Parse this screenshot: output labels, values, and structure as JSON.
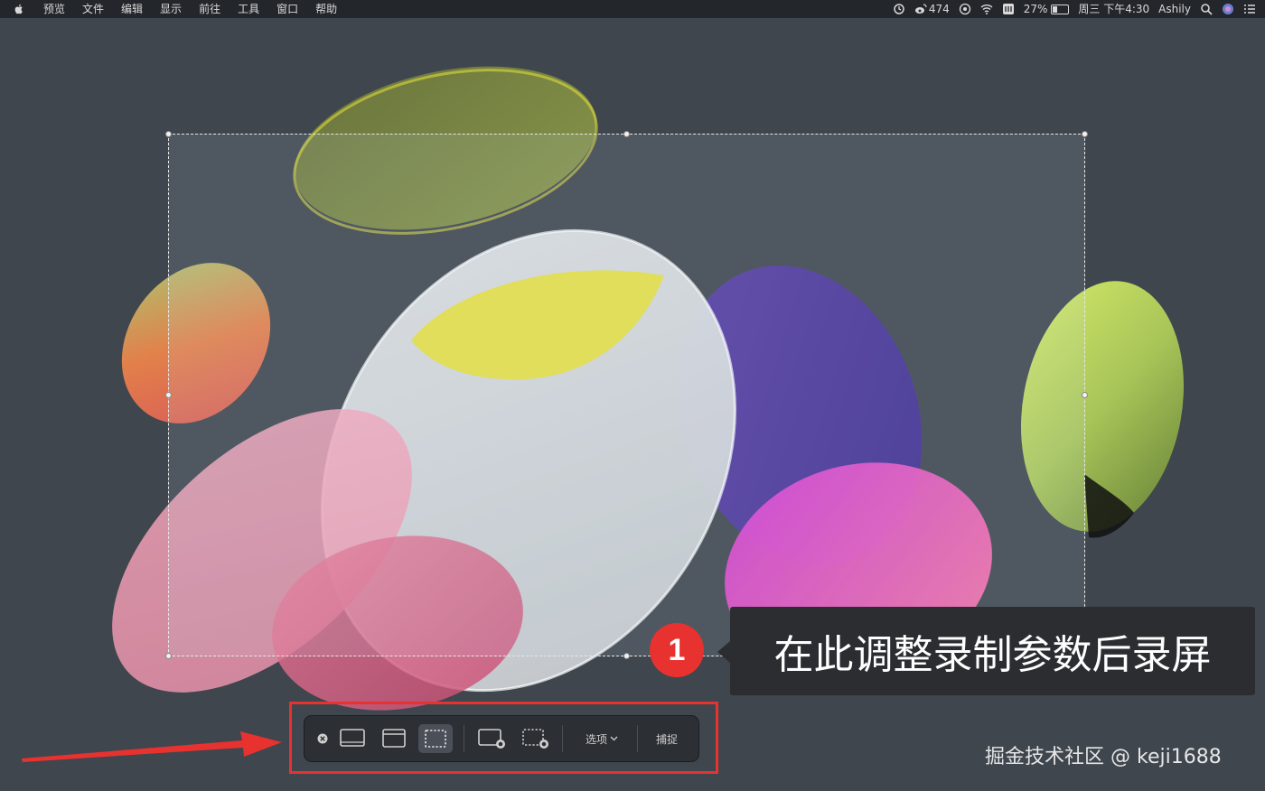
{
  "menubar": {
    "items": [
      "预览",
      "文件",
      "编辑",
      "显示",
      "前往",
      "工具",
      "窗口",
      "帮助"
    ],
    "status": {
      "weibo_count": "474",
      "battery": "27%",
      "datetime": "周三 下午4:30",
      "user": "Ashily"
    }
  },
  "toolbar": {
    "options_label": "选项",
    "capture_label": "捕捉"
  },
  "callout": {
    "step": "1",
    "text": "在此调整录制参数后录屏"
  },
  "watermark": "掘金技术社区 @ keji1688",
  "colors": {
    "accent_red": "#e8322f",
    "toolbar_bg": "#2c2f33",
    "desktop_bg": "#3f464e"
  }
}
